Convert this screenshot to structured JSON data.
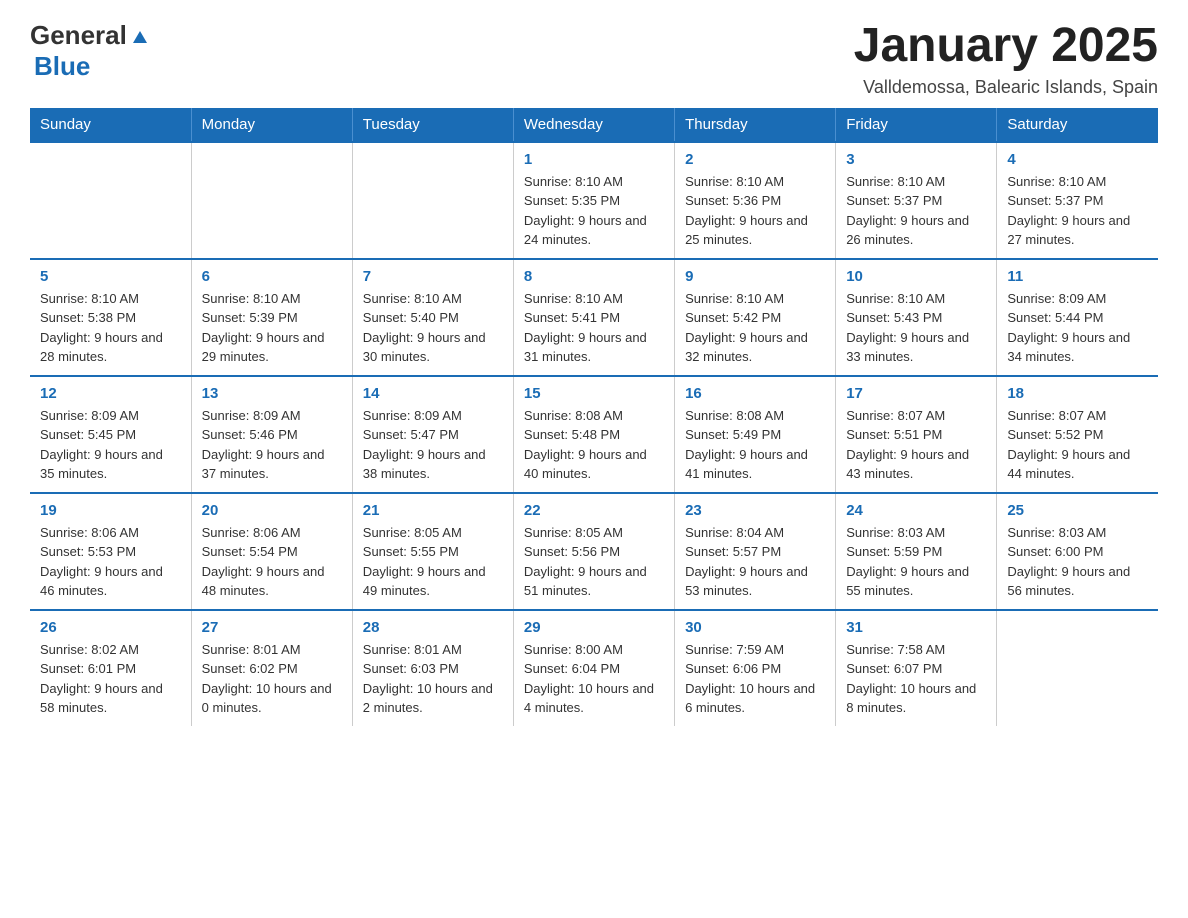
{
  "header": {
    "title": "January 2025",
    "subtitle": "Valldemossa, Balearic Islands, Spain"
  },
  "logo": {
    "text_general": "General",
    "text_blue": "Blue"
  },
  "calendar": {
    "headers": [
      "Sunday",
      "Monday",
      "Tuesday",
      "Wednesday",
      "Thursday",
      "Friday",
      "Saturday"
    ],
    "weeks": [
      [
        {
          "day": "",
          "info": ""
        },
        {
          "day": "",
          "info": ""
        },
        {
          "day": "",
          "info": ""
        },
        {
          "day": "1",
          "info": "Sunrise: 8:10 AM\nSunset: 5:35 PM\nDaylight: 9 hours and 24 minutes."
        },
        {
          "day": "2",
          "info": "Sunrise: 8:10 AM\nSunset: 5:36 PM\nDaylight: 9 hours and 25 minutes."
        },
        {
          "day": "3",
          "info": "Sunrise: 8:10 AM\nSunset: 5:37 PM\nDaylight: 9 hours and 26 minutes."
        },
        {
          "day": "4",
          "info": "Sunrise: 8:10 AM\nSunset: 5:37 PM\nDaylight: 9 hours and 27 minutes."
        }
      ],
      [
        {
          "day": "5",
          "info": "Sunrise: 8:10 AM\nSunset: 5:38 PM\nDaylight: 9 hours and 28 minutes."
        },
        {
          "day": "6",
          "info": "Sunrise: 8:10 AM\nSunset: 5:39 PM\nDaylight: 9 hours and 29 minutes."
        },
        {
          "day": "7",
          "info": "Sunrise: 8:10 AM\nSunset: 5:40 PM\nDaylight: 9 hours and 30 minutes."
        },
        {
          "day": "8",
          "info": "Sunrise: 8:10 AM\nSunset: 5:41 PM\nDaylight: 9 hours and 31 minutes."
        },
        {
          "day": "9",
          "info": "Sunrise: 8:10 AM\nSunset: 5:42 PM\nDaylight: 9 hours and 32 minutes."
        },
        {
          "day": "10",
          "info": "Sunrise: 8:10 AM\nSunset: 5:43 PM\nDaylight: 9 hours and 33 minutes."
        },
        {
          "day": "11",
          "info": "Sunrise: 8:09 AM\nSunset: 5:44 PM\nDaylight: 9 hours and 34 minutes."
        }
      ],
      [
        {
          "day": "12",
          "info": "Sunrise: 8:09 AM\nSunset: 5:45 PM\nDaylight: 9 hours and 35 minutes."
        },
        {
          "day": "13",
          "info": "Sunrise: 8:09 AM\nSunset: 5:46 PM\nDaylight: 9 hours and 37 minutes."
        },
        {
          "day": "14",
          "info": "Sunrise: 8:09 AM\nSunset: 5:47 PM\nDaylight: 9 hours and 38 minutes."
        },
        {
          "day": "15",
          "info": "Sunrise: 8:08 AM\nSunset: 5:48 PM\nDaylight: 9 hours and 40 minutes."
        },
        {
          "day": "16",
          "info": "Sunrise: 8:08 AM\nSunset: 5:49 PM\nDaylight: 9 hours and 41 minutes."
        },
        {
          "day": "17",
          "info": "Sunrise: 8:07 AM\nSunset: 5:51 PM\nDaylight: 9 hours and 43 minutes."
        },
        {
          "day": "18",
          "info": "Sunrise: 8:07 AM\nSunset: 5:52 PM\nDaylight: 9 hours and 44 minutes."
        }
      ],
      [
        {
          "day": "19",
          "info": "Sunrise: 8:06 AM\nSunset: 5:53 PM\nDaylight: 9 hours and 46 minutes."
        },
        {
          "day": "20",
          "info": "Sunrise: 8:06 AM\nSunset: 5:54 PM\nDaylight: 9 hours and 48 minutes."
        },
        {
          "day": "21",
          "info": "Sunrise: 8:05 AM\nSunset: 5:55 PM\nDaylight: 9 hours and 49 minutes."
        },
        {
          "day": "22",
          "info": "Sunrise: 8:05 AM\nSunset: 5:56 PM\nDaylight: 9 hours and 51 minutes."
        },
        {
          "day": "23",
          "info": "Sunrise: 8:04 AM\nSunset: 5:57 PM\nDaylight: 9 hours and 53 minutes."
        },
        {
          "day": "24",
          "info": "Sunrise: 8:03 AM\nSunset: 5:59 PM\nDaylight: 9 hours and 55 minutes."
        },
        {
          "day": "25",
          "info": "Sunrise: 8:03 AM\nSunset: 6:00 PM\nDaylight: 9 hours and 56 minutes."
        }
      ],
      [
        {
          "day": "26",
          "info": "Sunrise: 8:02 AM\nSunset: 6:01 PM\nDaylight: 9 hours and 58 minutes."
        },
        {
          "day": "27",
          "info": "Sunrise: 8:01 AM\nSunset: 6:02 PM\nDaylight: 10 hours and 0 minutes."
        },
        {
          "day": "28",
          "info": "Sunrise: 8:01 AM\nSunset: 6:03 PM\nDaylight: 10 hours and 2 minutes."
        },
        {
          "day": "29",
          "info": "Sunrise: 8:00 AM\nSunset: 6:04 PM\nDaylight: 10 hours and 4 minutes."
        },
        {
          "day": "30",
          "info": "Sunrise: 7:59 AM\nSunset: 6:06 PM\nDaylight: 10 hours and 6 minutes."
        },
        {
          "day": "31",
          "info": "Sunrise: 7:58 AM\nSunset: 6:07 PM\nDaylight: 10 hours and 8 minutes."
        },
        {
          "day": "",
          "info": ""
        }
      ]
    ]
  }
}
